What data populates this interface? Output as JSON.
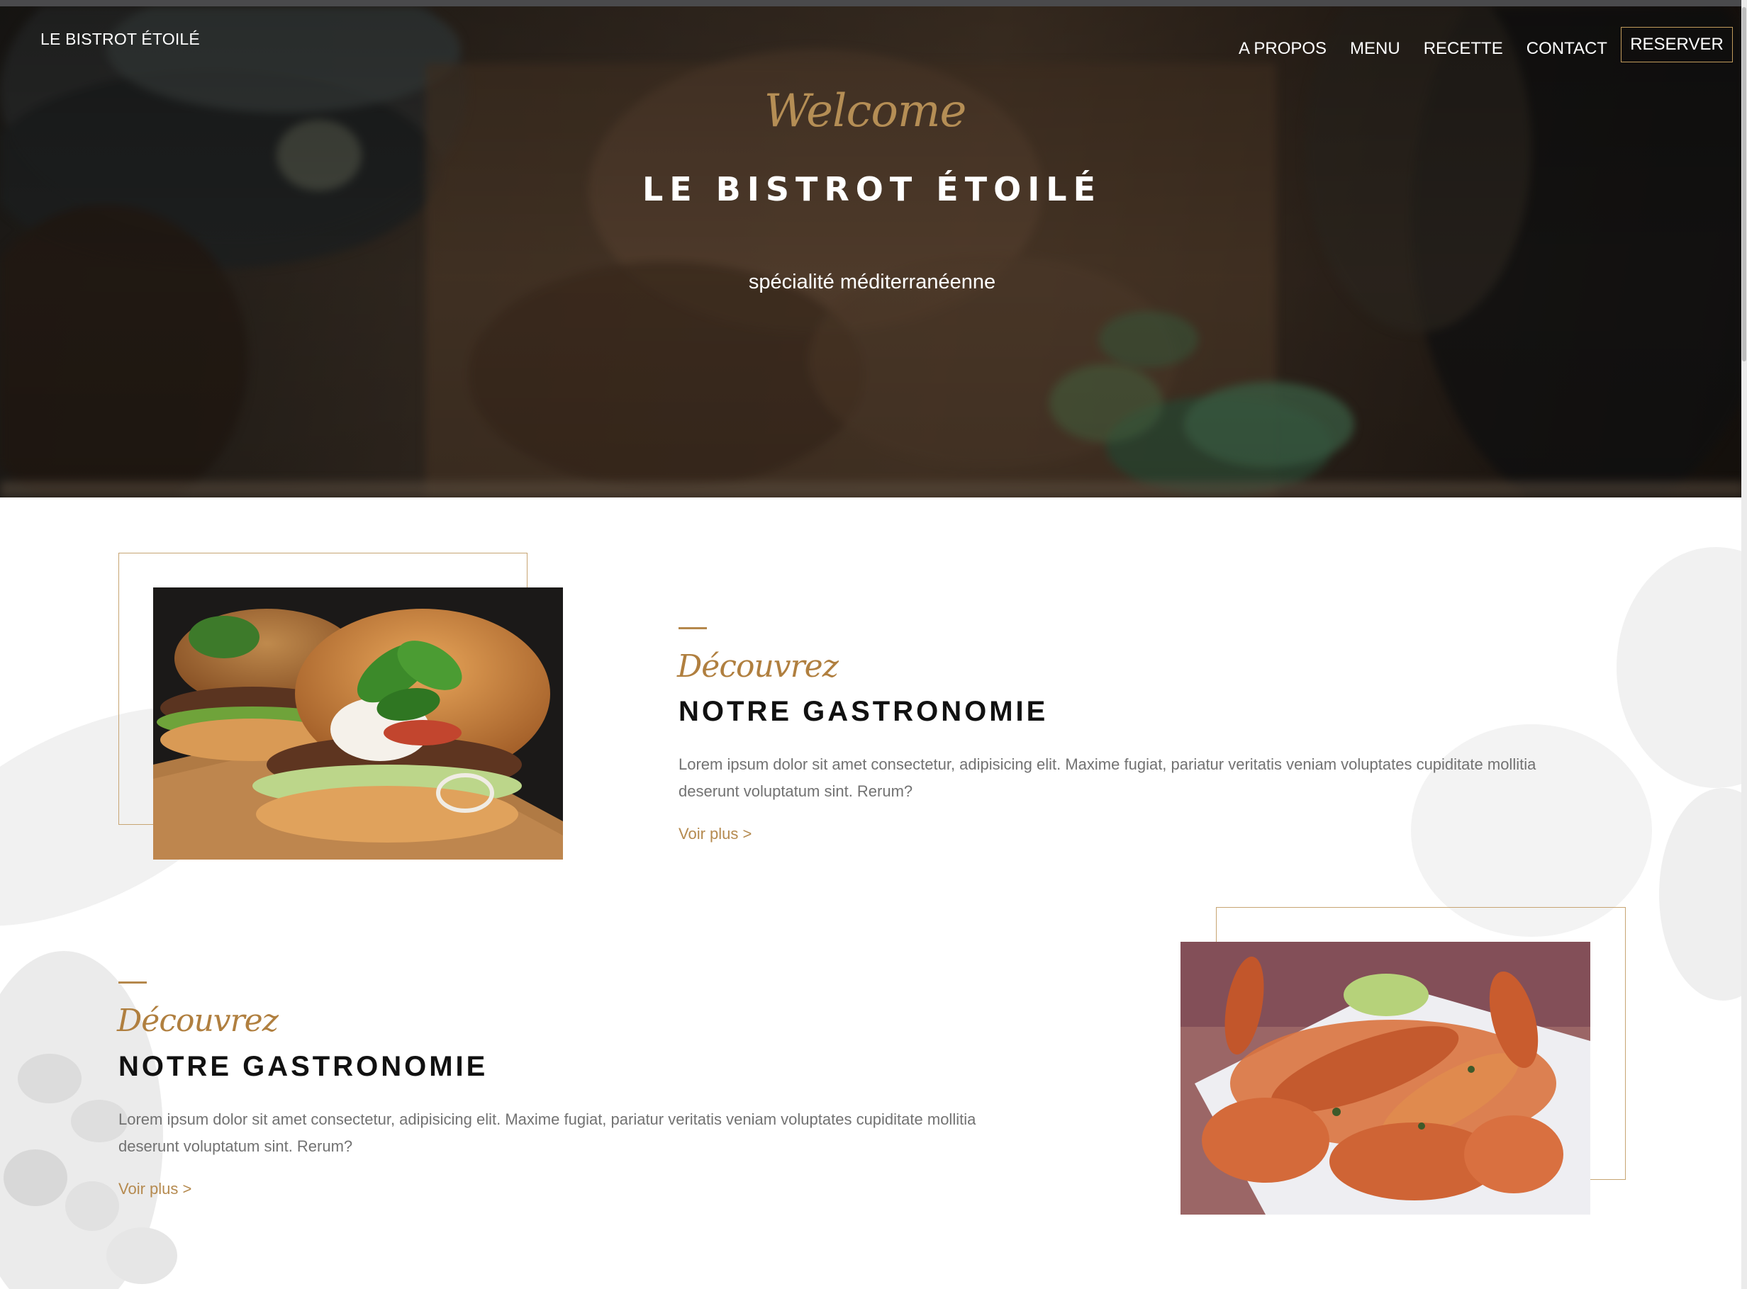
{
  "header": {
    "brand": "LE BISTROT ÉTOILÉ",
    "nav": [
      {
        "label": "A PROPOS"
      },
      {
        "label": "MENU"
      },
      {
        "label": "RECETTE"
      },
      {
        "label": "CONTACT"
      }
    ],
    "reserve_label": "RESERVER"
  },
  "hero": {
    "script": "Welcome",
    "title": "LE BISTROT ÉTOILÉ",
    "subtitle": "spécialité méditerranéenne"
  },
  "sections": [
    {
      "kicker": "Découvrez",
      "title": "NOTRE GASTRONOMIE",
      "text": "Lorem ipsum dolor sit amet consectetur, adipisicing elit. Maxime fugiat, pariatur veritatis veniam voluptates cupiditate mollitia deserunt voluptatum sint. Rerum?",
      "link": "Voir plus >",
      "image": "burger"
    },
    {
      "kicker": "Découvrez",
      "title": "NOTRE GASTRONOMIE",
      "text": "Lorem ipsum dolor sit amet consectetur, adipisicing elit. Maxime fugiat, pariatur veritatis veniam voluptates cupiditate mollitia deserunt voluptatum sint. Rerum?",
      "link": "Voir plus >",
      "image": "grilled-shrimp"
    }
  ],
  "colors": {
    "accent": "#b58a4f",
    "frame": "#c7a573",
    "title": "#111111",
    "body": "#727272"
  }
}
